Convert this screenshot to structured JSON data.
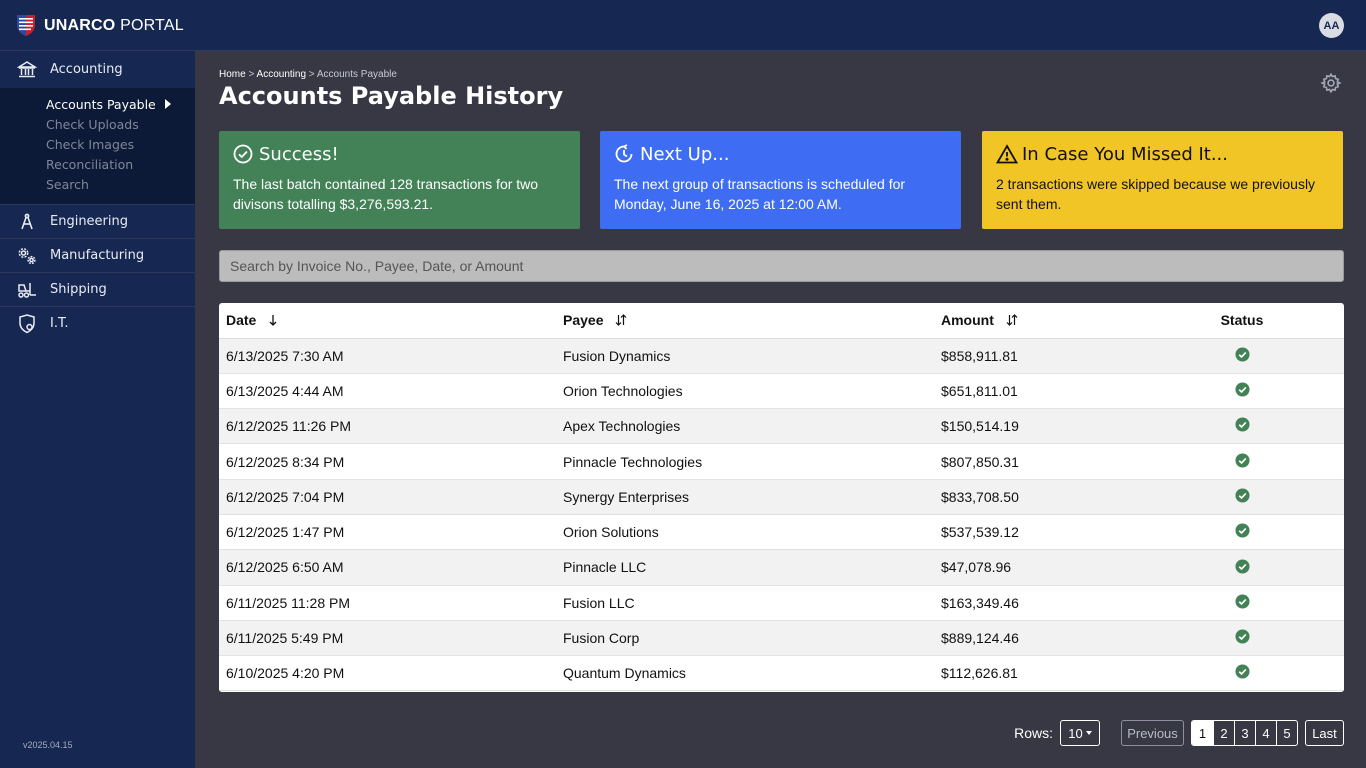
{
  "app": {
    "brand_bold": "UNARCO",
    "brand_light": "PORTAL",
    "avatar_initials": "AA",
    "version": "v2025.04.15"
  },
  "sidebar": {
    "sections": [
      {
        "label": "Accounting",
        "icon": "bank-icon"
      },
      {
        "label": "Engineering",
        "icon": "compass-icon"
      },
      {
        "label": "Manufacturing",
        "icon": "gears-icon"
      },
      {
        "label": "Shipping",
        "icon": "forklift-icon"
      },
      {
        "label": "I.T.",
        "icon": "shield-gear-icon"
      }
    ],
    "accounting_subitems": [
      {
        "label": "Accounts Payable",
        "active": true
      },
      {
        "label": "Check Uploads"
      },
      {
        "label": "Check Images"
      },
      {
        "label": "Reconciliation"
      },
      {
        "label": "Search"
      }
    ]
  },
  "breadcrumb": {
    "home": "Home",
    "sep": " > ",
    "section": "Accounting",
    "current": "Accounts Payable"
  },
  "page": {
    "title": "Accounts Payable History"
  },
  "cards": {
    "success": {
      "title": "Success!",
      "body": "The last batch contained 128 transactions for two divisons totalling $3,276,593.21.",
      "color": "#438156"
    },
    "next": {
      "title": "Next Up...",
      "body": "The next group of transactions is scheduled for Monday, June 16, 2025 at 12:00 AM.",
      "color": "#3e6df3"
    },
    "warn": {
      "title": "In Case You Missed It...",
      "body": "2 transactions were skipped because we previously sent them.",
      "color": "#f2c526"
    }
  },
  "search": {
    "placeholder": "Search by Invoice No., Payee, Date, or Amount"
  },
  "table": {
    "headers": {
      "date": "Date",
      "payee": "Payee",
      "amount": "Amount",
      "status": "Status"
    },
    "rows": [
      {
        "date": "6/13/2025 7:30 AM",
        "payee": "Fusion Dynamics",
        "amount": "$858,911.81",
        "status": "success"
      },
      {
        "date": "6/13/2025 4:44 AM",
        "payee": "Orion Technologies",
        "amount": "$651,811.01",
        "status": "success"
      },
      {
        "date": "6/12/2025 11:26 PM",
        "payee": "Apex Technologies",
        "amount": "$150,514.19",
        "status": "success"
      },
      {
        "date": "6/12/2025 8:34 PM",
        "payee": "Pinnacle Technologies",
        "amount": "$807,850.31",
        "status": "success"
      },
      {
        "date": "6/12/2025 7:04 PM",
        "payee": "Synergy Enterprises",
        "amount": "$833,708.50",
        "status": "success"
      },
      {
        "date": "6/12/2025 1:47 PM",
        "payee": "Orion Solutions",
        "amount": "$537,539.12",
        "status": "success"
      },
      {
        "date": "6/12/2025 6:50 AM",
        "payee": "Pinnacle LLC",
        "amount": "$47,078.96",
        "status": "success"
      },
      {
        "date": "6/11/2025 11:28 PM",
        "payee": "Fusion LLC",
        "amount": "$163,349.46",
        "status": "success"
      },
      {
        "date": "6/11/2025 5:49 PM",
        "payee": "Fusion Corp",
        "amount": "$889,124.46",
        "status": "success"
      },
      {
        "date": "6/10/2025 4:20 PM",
        "payee": "Quantum Dynamics",
        "amount": "$112,626.81",
        "status": "success"
      }
    ]
  },
  "pagination": {
    "rows_label": "Rows:",
    "rows_value": "10",
    "previous": "Previous",
    "pages": [
      "1",
      "2",
      "3",
      "4",
      "5"
    ],
    "current_page": "1",
    "last": "Last"
  },
  "colors": {
    "topbar": "#162852",
    "background": "#383845",
    "status_success": "#438156"
  }
}
